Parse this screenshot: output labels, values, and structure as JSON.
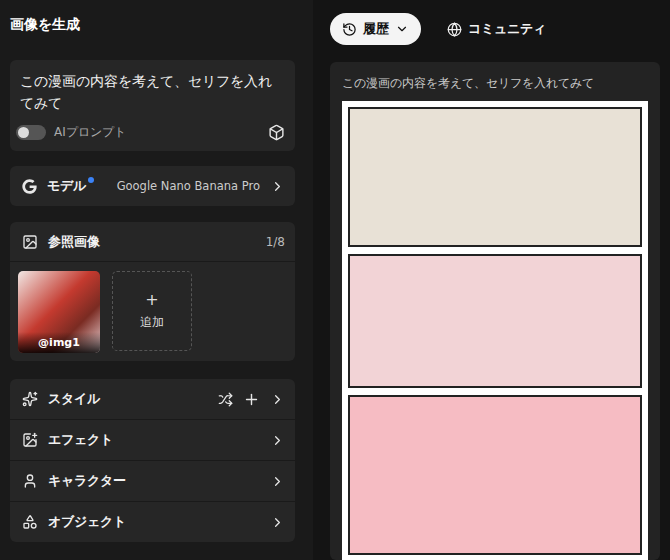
{
  "header": {
    "title": "画像を生成"
  },
  "prompt": {
    "text": "この漫画の内容を考えて、セリフを入れてみて",
    "ai_prompt": {
      "label": "AIプロンプト",
      "on": false
    }
  },
  "model": {
    "label": "モデル",
    "value": "Google Nano Banana Pro",
    "notice": true
  },
  "reference_images": {
    "label": "参照画像",
    "count": "1/8",
    "images": [
      {
        "tag": "@img1"
      }
    ],
    "add_icon": "+",
    "add_label": "追加"
  },
  "options": [
    {
      "label": "スタイル",
      "kind": "actions"
    },
    {
      "label": "エフェクト",
      "kind": "plain"
    },
    {
      "label": "キャラクター",
      "kind": "plain"
    },
    {
      "label": "オブジェクト",
      "kind": "plain"
    }
  ],
  "top_bar": {
    "history": {
      "label": "履歴",
      "selected": true
    },
    "community": {
      "label": "コミュニティ",
      "selected": false
    }
  },
  "result": {
    "prompt": "この漫画の内容を考えて、セリフを入れてみて",
    "panels": [
      {
        "color": "#e8e1d6"
      },
      {
        "color": "#f2d3d6"
      },
      {
        "color": "#f6bcc3"
      }
    ]
  }
}
